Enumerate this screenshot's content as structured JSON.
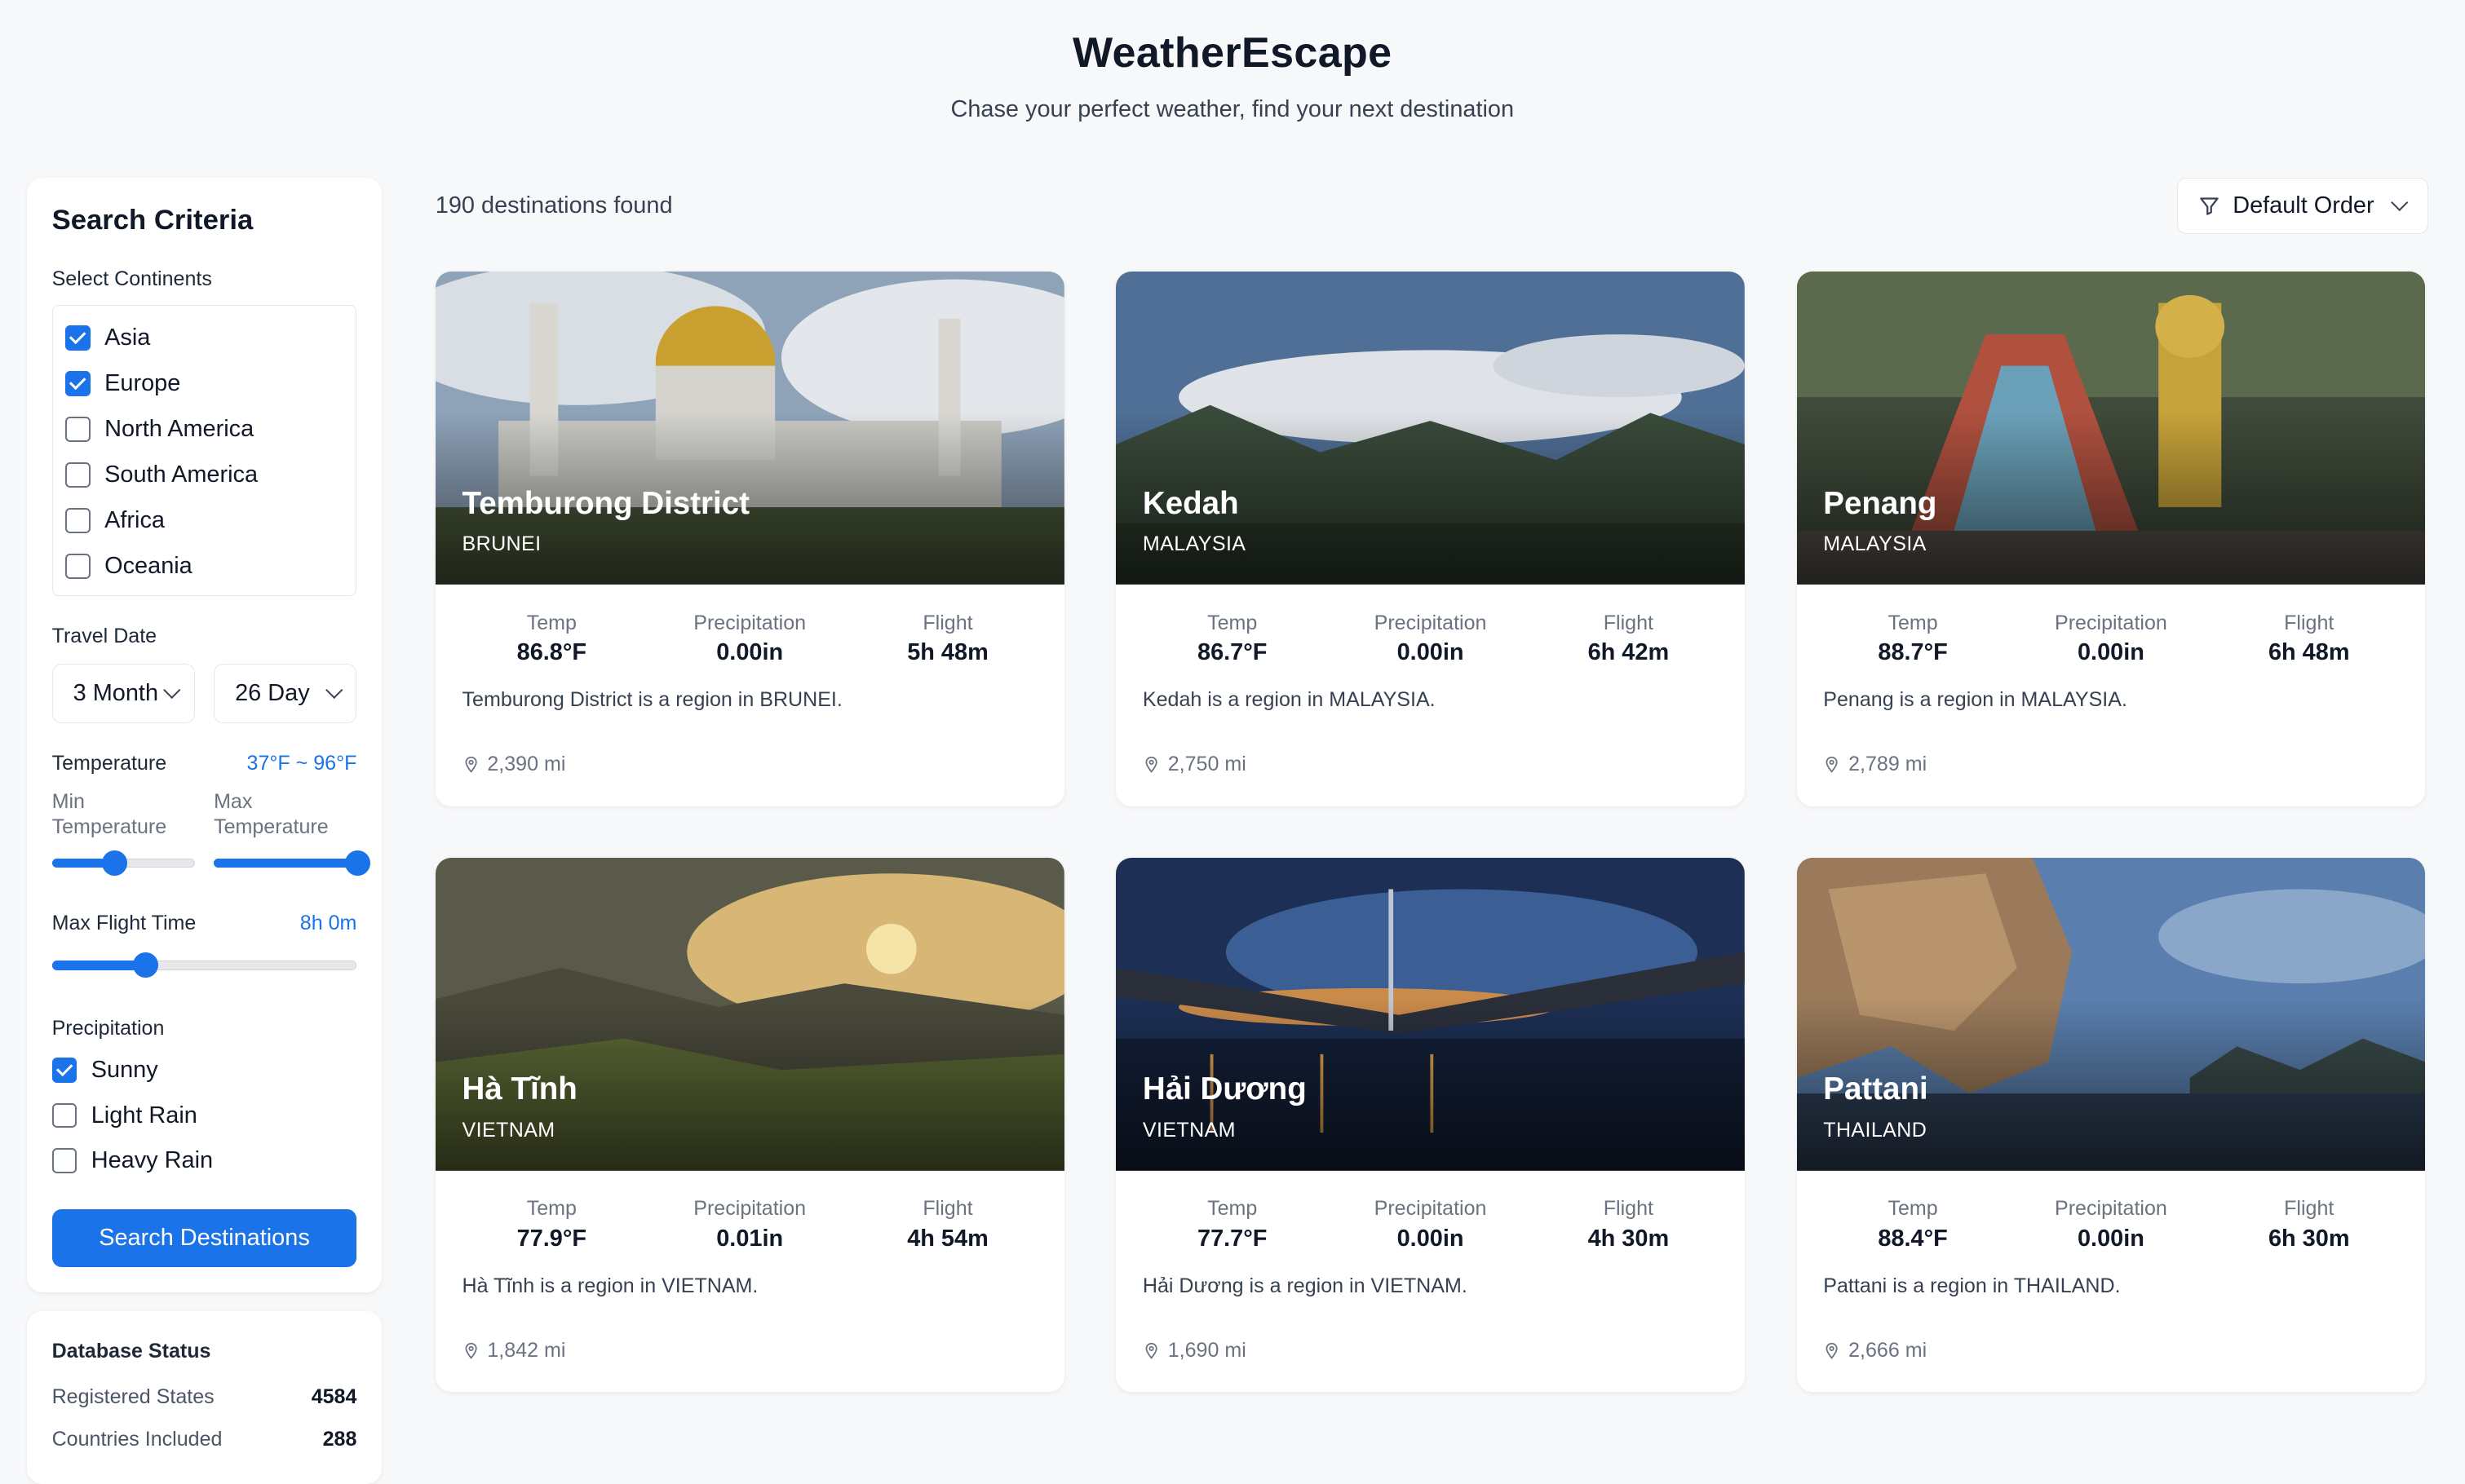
{
  "header": {
    "title": "WeatherEscape",
    "subtitle": "Chase your perfect weather, find your next destination"
  },
  "sidebar": {
    "title": "Search Criteria",
    "continents_label": "Select Continents",
    "continents": [
      {
        "label": "Asia",
        "checked": true
      },
      {
        "label": "Europe",
        "checked": true
      },
      {
        "label": "North America",
        "checked": false
      },
      {
        "label": "South America",
        "checked": false
      },
      {
        "label": "Africa",
        "checked": false
      },
      {
        "label": "Oceania",
        "checked": false
      }
    ],
    "travel_date_label": "Travel Date",
    "month_select": "3 Month",
    "day_select": "26 Day",
    "temperature_label": "Temperature",
    "temperature_range": "37°F ~ 96°F",
    "min_temp_label": "Min Temperature",
    "max_temp_label": "Max Temperature",
    "min_temp_level": 0.38,
    "max_temp_level": 1.0,
    "flight_label": "Max Flight Time",
    "flight_value": "8h 0m",
    "flight_level": 0.29,
    "precip_label": "Precipitation",
    "precip": [
      {
        "label": "Sunny",
        "checked": true
      },
      {
        "label": "Light Rain",
        "checked": false
      },
      {
        "label": "Heavy Rain",
        "checked": false
      }
    ],
    "search_button": "Search Destinations"
  },
  "db": {
    "title": "Database Status",
    "rows": [
      {
        "label": "Registered States",
        "value": "4584"
      },
      {
        "label": "Countries Included",
        "value": "288"
      }
    ]
  },
  "main": {
    "count": "190 destinations found",
    "order_label": "Default Order",
    "stat_labels": {
      "temp": "Temp",
      "precip": "Precipitation",
      "flight": "Flight"
    },
    "cards": [
      {
        "name": "Temburong District",
        "country": "BRUNEI",
        "temp": "86.8°F",
        "precip": "0.00in",
        "flight": "5h 48m",
        "desc": "Temburong District is a region in BRUNEI.",
        "distance": "2,390 mi"
      },
      {
        "name": "Kedah",
        "country": "MALAYSIA",
        "temp": "86.7°F",
        "precip": "0.00in",
        "flight": "6h 42m",
        "desc": "Kedah is a region in MALAYSIA.",
        "distance": "2,750 mi"
      },
      {
        "name": "Penang",
        "country": "MALAYSIA",
        "temp": "88.7°F",
        "precip": "0.00in",
        "flight": "6h 48m",
        "desc": "Penang is a region in MALAYSIA.",
        "distance": "2,789 mi"
      },
      {
        "name": "Hà Tĩnh",
        "country": "VIETNAM",
        "temp": "77.9°F",
        "precip": "0.01in",
        "flight": "4h 54m",
        "desc": "Hà Tĩnh is a region in VIETNAM.",
        "distance": "1,842 mi"
      },
      {
        "name": "Hải Dương",
        "country": "VIETNAM",
        "temp": "77.7°F",
        "precip": "0.00in",
        "flight": "4h 30m",
        "desc": "Hải Dương is a region in VIETNAM.",
        "distance": "1,690 mi"
      },
      {
        "name": "Pattani",
        "country": "THAILAND",
        "temp": "88.4°F",
        "precip": "0.00in",
        "flight": "6h 30m",
        "desc": "Pattani is a region in THAILAND.",
        "distance": "2,666 mi"
      }
    ]
  },
  "colors": {
    "accent": "#1a73e8",
    "background": "#f7f8fa"
  }
}
